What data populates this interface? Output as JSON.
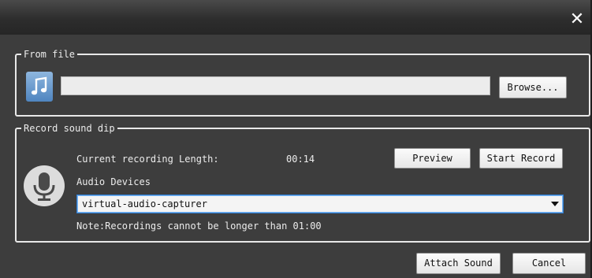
{
  "titlebar": {
    "close_glyph": "✕"
  },
  "from_file": {
    "legend": "From file",
    "icon": "music-note-icon",
    "file_path_value": "",
    "browse_label": "Browse..."
  },
  "record": {
    "legend": "Record sound dip",
    "icon": "microphone-icon",
    "length_label": "Current recording Length:",
    "length_value": "00:14",
    "preview_label": "Preview",
    "start_record_label": "Start Record",
    "audio_devices_label": "Audio Devices",
    "audio_device_selected": "virtual-audio-capturer",
    "note": "Note:Recordings cannot be longer than 01:00"
  },
  "footer": {
    "attach_label": "Attach Sound",
    "cancel_label": "Cancel"
  },
  "colors": {
    "dialog_bg": "#3d3d3d",
    "text": "#ececec",
    "select_focus": "#2f7fd6",
    "note_icon": "#4f85c0"
  }
}
